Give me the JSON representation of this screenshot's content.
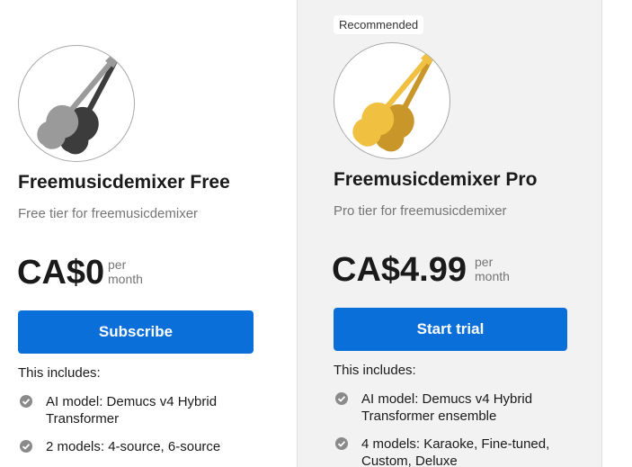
{
  "plans": [
    {
      "title": "Freemusicdemixer Free",
      "description": "Free tier for freemusicdemixer",
      "price": "CA$0",
      "per": "per",
      "period": "month",
      "cta": "Subscribe",
      "includes_label": "This includes:",
      "features": [
        "AI model: Demucs v4 Hybrid Transformer",
        "2 models: 4-source, 6-source"
      ],
      "image_icon": "guitars-gray-icon"
    },
    {
      "badge": "Recommended",
      "title": "Freemusicdemixer Pro",
      "description": "Pro tier for freemusicdemixer",
      "price": "CA$4.99",
      "per": "per",
      "period": "month",
      "cta": "Start trial",
      "includes_label": "This includes:",
      "features": [
        "AI model: Demucs v4 Hybrid Transformer ensemble",
        "4 models: Karaoke, Fine-tuned, Custom, Deluxe"
      ],
      "image_icon": "guitars-gold-icon"
    }
  ],
  "colors": {
    "cta_background": "#0a6fd8",
    "pro_panel_background": "#f2f2f2",
    "check_icon": "#8a8a8a",
    "free_guitar_light": "#9a9a9a",
    "free_guitar_dark": "#3c3c3c",
    "pro_guitar_light": "#f0c040",
    "pro_guitar_dark": "#c9962a"
  }
}
